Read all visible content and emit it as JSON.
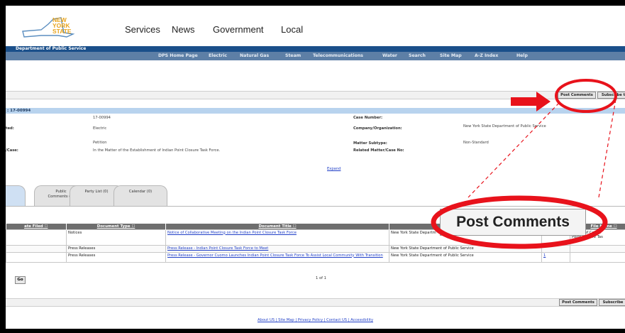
{
  "logo": {
    "lines": [
      "NEW",
      "YORK",
      "STATE"
    ]
  },
  "top_nav": [
    "Services",
    "News",
    "Government",
    "Local"
  ],
  "dps_title": "Department of Public Service",
  "menu": [
    "DPS Home Page",
    "Electric",
    "Natural Gas",
    "Steam",
    "Telecommunications",
    "Water",
    "Search",
    "Site Map",
    "A-Z Index",
    "Help"
  ],
  "toolbar": {
    "post_comments": "Post Comments",
    "subscribe": "Subscribe t",
    "subscribe_bottom": "Subscribe"
  },
  "case_strip": ": 17-00994",
  "details": {
    "left_val_case": "17-00994",
    "left_label_2": "ted:",
    "left_val_2": "Electric",
    "left_val_3": "Petition",
    "left_label_4": "/Case:",
    "left_val_4": "In the Matter of the Establishment of Indian Point Closure Task Force.",
    "case_number_label": "Case Number:",
    "company_label": "Company/Organization:",
    "company_value": "New York State Department of Public Service",
    "matter_subtype_label": "Matter Subtype:",
    "matter_subtype_value": "Non-Standard",
    "related_label": "Related Matter/Case No:",
    "expand": "Expand"
  },
  "tabs": [
    {
      "line1": "Public",
      "line2": "Comments (0)"
    },
    {
      "line1": "Party List (0)",
      "line2": ""
    },
    {
      "line1": "Calendar (0)",
      "line2": ""
    }
  ],
  "table": {
    "headers": [
      "ate Filed",
      "Document Type",
      "Document Title",
      "",
      "",
      "File Name"
    ],
    "rows": [
      {
        "type": "Notices",
        "title": "Notice of Collaborative Meeting on the Indian Point Closure Task Force",
        "org": "New York State Departm",
        "count": "",
        "file": "Notice of Collab\nPoint Closure Tas"
      },
      {
        "type": "Press Releases",
        "title": "Press Release - Indian Point Closure Task Force to Meet",
        "org": "New York State Department of Public Service",
        "count": "",
        "file": ""
      },
      {
        "type": "Press Releases",
        "title": "Press Release - Governor Cuomo Launches Indian Point Closure Task Force To Assist Local Community With Transition",
        "org": "New York State Department of Public Service",
        "count": "1",
        "file": "go"
      }
    ]
  },
  "pager": {
    "go": "Go",
    "text": "1 of 1"
  },
  "zoom_callout": "Post Comments",
  "footer": [
    "About US",
    "Site Map",
    "Privacy Policy",
    "Contact US",
    "Accessibility"
  ],
  "colors": {
    "annotation_red": "#e8121b",
    "nav_blue": "#1a4f8a",
    "menu_blue": "#5d7fa6"
  }
}
